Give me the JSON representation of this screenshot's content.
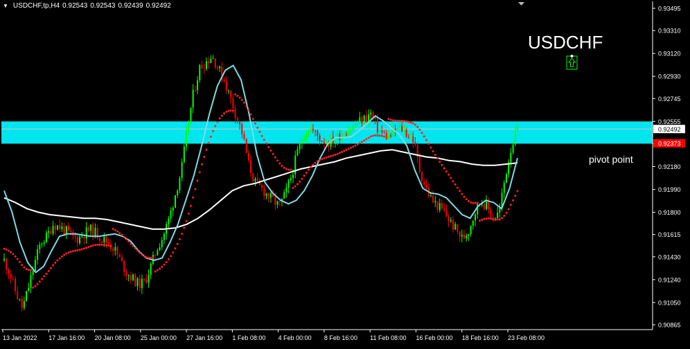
{
  "header": {
    "symbol": "USDCHF,tp,H4",
    "open": "0.92543",
    "high": "0.92543",
    "low": "0.92439",
    "close": "0.92492"
  },
  "annotations": {
    "symbol_label": "USDCHF",
    "pivot_label": "pivot point"
  },
  "colors": {
    "background": "#000000",
    "bull_candle": "#00ff00",
    "bear_candle": "#ff0000",
    "sar": "#ff2020",
    "fast_ma": "#7fdbe8",
    "slow_ma": "#ffffff",
    "pivot_zone": "#00e5ee",
    "axis": "#ffffff",
    "current_price_label": "#ffffff",
    "pivot_price_label": "#ff0000"
  },
  "chart_data": {
    "type": "candlestick",
    "price_axis": {
      "ticks": [
        "0.93495",
        "0.93310",
        "0.93120",
        "0.92930",
        "0.92745",
        "0.92555",
        "0.92370",
        "0.92180",
        "0.91990",
        "0.91800",
        "0.91615",
        "0.91430",
        "0.91240",
        "0.91050",
        "0.90865"
      ],
      "range": [
        0.90865,
        0.93495
      ]
    },
    "time_axis": {
      "ticks": [
        "13 Jan 2022",
        "17 Jan 16:00",
        "20 Jan 08:00",
        "25 Jan 00:00",
        "27 Jan 16:00",
        "1 Feb 08:00",
        "4 Feb 00:00",
        "8 Feb 16:00",
        "11 Feb 08:00",
        "16 Feb 00:00",
        "18 Feb 16:00",
        "23 Feb 08:00"
      ]
    },
    "current_price": "0.92492",
    "pivot_price": "0.92373",
    "pivot_zone": [
      0.9237,
      0.92555
    ],
    "close_path": [
      0.914,
      0.9128,
      0.9112,
      0.91,
      0.9118,
      0.9138,
      0.9155,
      0.916,
      0.917,
      0.9168,
      0.9165,
      0.916,
      0.9158,
      0.9162,
      0.9166,
      0.9163,
      0.9158,
      0.9155,
      0.915,
      0.914,
      0.913,
      0.9125,
      0.912,
      0.9122,
      0.9135,
      0.915,
      0.916,
      0.9175,
      0.9195,
      0.9215,
      0.925,
      0.928,
      0.93,
      0.9305,
      0.931,
      0.93,
      0.929,
      0.9275,
      0.926,
      0.9245,
      0.922,
      0.9205,
      0.92,
      0.9195,
      0.919,
      0.9185,
      0.9195,
      0.921,
      0.923,
      0.9245,
      0.925,
      0.9245,
      0.924,
      0.9238,
      0.924,
      0.9245,
      0.9248,
      0.925,
      0.9255,
      0.9258,
      0.9262,
      0.925,
      0.9245,
      0.9242,
      0.9248,
      0.925,
      0.9245,
      0.924,
      0.9215,
      0.92,
      0.919,
      0.9185,
      0.918,
      0.9172,
      0.9165,
      0.9158,
      0.9165,
      0.918,
      0.919,
      0.9185,
      0.9175,
      0.918,
      0.921,
      0.9235,
      0.9249
    ],
    "fast_ma": [
      0.9198,
      0.918,
      0.9155,
      0.9138,
      0.913,
      0.9135,
      0.9148,
      0.916,
      0.9162,
      0.9162,
      0.9161,
      0.916,
      0.916,
      0.9161,
      0.9162,
      0.916,
      0.9156,
      0.9148,
      0.9142,
      0.914,
      0.9142,
      0.9155,
      0.917,
      0.919,
      0.921,
      0.9235,
      0.9262,
      0.9285,
      0.9298,
      0.9302,
      0.929,
      0.9262,
      0.9228,
      0.9205,
      0.9196,
      0.919,
      0.9187,
      0.919,
      0.9198,
      0.921,
      0.9225,
      0.9237,
      0.9242,
      0.9242,
      0.9243,
      0.9248,
      0.9254,
      0.926,
      0.9256,
      0.925,
      0.9245,
      0.9235,
      0.9215,
      0.92,
      0.9196,
      0.9195,
      0.9192,
      0.9185,
      0.9178,
      0.9175,
      0.9185,
      0.919,
      0.9188,
      0.9183,
      0.92,
      0.9225
    ],
    "slow_ma": [
      0.9192,
      0.9188,
      0.9183,
      0.918,
      0.9178,
      0.9177,
      0.9176,
      0.9175,
      0.9175,
      0.9174,
      0.9172,
      0.917,
      0.9168,
      0.9166,
      0.9166,
      0.9167,
      0.917,
      0.9175,
      0.9182,
      0.919,
      0.9198,
      0.9202,
      0.9204,
      0.9207,
      0.921,
      0.9213,
      0.9216,
      0.9218,
      0.922,
      0.9222,
      0.9225,
      0.9227,
      0.9229,
      0.9231,
      0.9232,
      0.923,
      0.9228,
      0.9226,
      0.9225,
      0.9223,
      0.9222,
      0.922,
      0.9219,
      0.9219,
      0.922,
      0.9221
    ]
  }
}
